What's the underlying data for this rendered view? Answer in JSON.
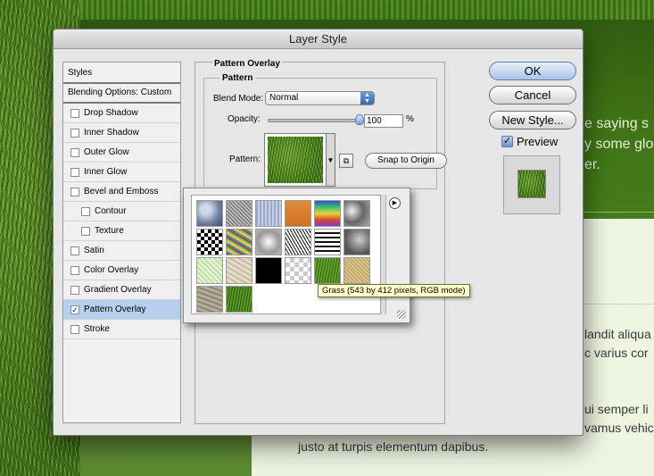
{
  "background": {
    "header_lines": [
      "e saying s",
      "y some glo",
      "er."
    ],
    "body_lines": [
      "landit aliqua",
      "c varius cor",
      "ui semper li",
      "vamus vehic",
      "justo at turpis elementum dapibus."
    ]
  },
  "dialog": {
    "title": "Layer Style"
  },
  "styles_panel": {
    "header": "Styles",
    "blending": "Blending Options: Custom",
    "items": [
      {
        "label": "Drop Shadow",
        "checked": false,
        "indent": false
      },
      {
        "label": "Inner Shadow",
        "checked": false,
        "indent": false
      },
      {
        "label": "Outer Glow",
        "checked": false,
        "indent": false
      },
      {
        "label": "Inner Glow",
        "checked": false,
        "indent": false
      },
      {
        "label": "Bevel and Emboss",
        "checked": false,
        "indent": false
      },
      {
        "label": "Contour",
        "checked": false,
        "indent": true
      },
      {
        "label": "Texture",
        "checked": false,
        "indent": true
      },
      {
        "label": "Satin",
        "checked": false,
        "indent": false
      },
      {
        "label": "Color Overlay",
        "checked": false,
        "indent": false
      },
      {
        "label": "Gradient Overlay",
        "checked": false,
        "indent": false
      },
      {
        "label": "Pattern Overlay",
        "checked": true,
        "indent": false,
        "selected": true
      },
      {
        "label": "Stroke",
        "checked": false,
        "indent": false
      }
    ]
  },
  "pattern_overlay": {
    "group_title": "Pattern Overlay",
    "sub_title": "Pattern",
    "blend_mode_label": "Blend Mode:",
    "blend_mode_value": "Normal",
    "opacity_label": "Opacity:",
    "opacity_value": "100",
    "opacity_unit": "%",
    "opacity_fraction": 1.0,
    "pattern_label": "Pattern:",
    "snap_button": "Snap to Origin"
  },
  "buttons": {
    "ok": "OK",
    "cancel": "Cancel",
    "new_style": "New Style...",
    "preview_label": "Preview",
    "preview_checked": true
  },
  "picker": {
    "tooltip": "Grass (543 by 412 pixels, RGB mode)",
    "tiles": [
      "bubbles",
      "gray-noise",
      "blue-stripes",
      "orange-fill",
      "rainbow",
      "gray-clouds",
      "checker",
      "color-noise",
      "soft-clouds",
      "speckle",
      "black-streaks",
      "gray-granite",
      "green-lace",
      "beige-marble",
      "black-square",
      "transparency",
      "grass",
      "sand",
      "stone",
      "grass-dark"
    ]
  },
  "colors": {
    "accent": "#3766b7",
    "selection": "#b7d0ee",
    "tooltip_bg": "#ffffc6"
  }
}
